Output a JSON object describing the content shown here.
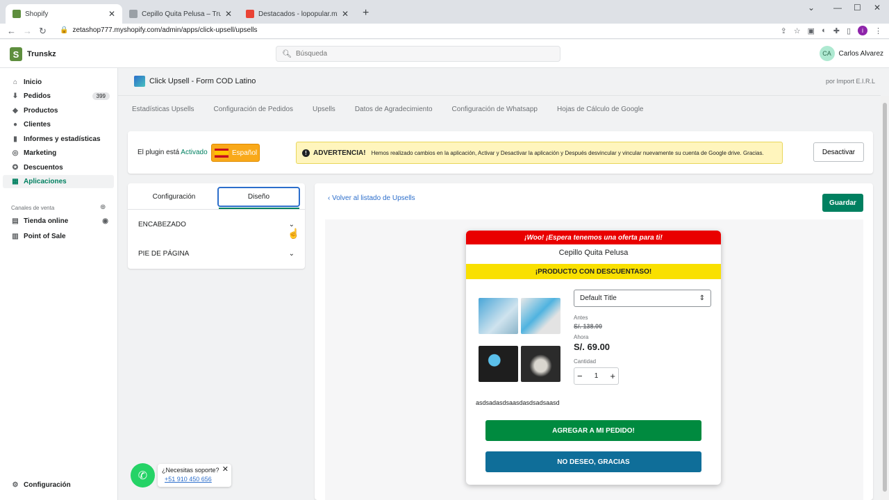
{
  "browser": {
    "tabs": [
      {
        "label": "Shopify",
        "active": true
      },
      {
        "label": "Cepillo Quita Pelusa – Trunskz",
        "active": false
      },
      {
        "label": "Destacados - lopopular.mx@gm...",
        "active": false
      }
    ],
    "url": "zetashop777.myshopify.com/admin/apps/click-upsell/upsells"
  },
  "topbar": {
    "store_name": "Trunskz",
    "search_placeholder": "Búsqueda",
    "user_initials": "CA",
    "user_name": "Carlos Alvarez"
  },
  "sidebar": {
    "items": [
      {
        "label": "Inicio",
        "icon": "home-icon"
      },
      {
        "label": "Pedidos",
        "icon": "orders-icon",
        "badge": "399"
      },
      {
        "label": "Productos",
        "icon": "tag-icon"
      },
      {
        "label": "Clientes",
        "icon": "person-icon"
      },
      {
        "label": "Informes y estadísticas",
        "icon": "bar-chart-icon"
      },
      {
        "label": "Marketing",
        "icon": "target-icon"
      },
      {
        "label": "Descuentos",
        "icon": "discount-icon"
      },
      {
        "label": "Aplicaciones",
        "icon": "apps-icon",
        "active": true
      }
    ],
    "channels_title": "Canales de venta",
    "channels": [
      {
        "label": "Tienda online",
        "icon": "store-icon"
      },
      {
        "label": "Point of Sale",
        "icon": "pos-icon"
      }
    ],
    "settings_label": "Configuración"
  },
  "app": {
    "title": "Click Upsell - Form COD Latino",
    "byline": "por Import E.I.R.L",
    "tabs": [
      "Estadísticas Upsells",
      "Configuración de Pedidos",
      "Upsells",
      "Datos de Agradecimiento",
      "Configuración de Whatsapp",
      "Hojas de Cálculo de Google"
    ],
    "plugin_state_prefix": "El plugin está",
    "plugin_state": "Activado",
    "language": "Español",
    "warning_title": "ADVERTENCIA!",
    "warning_text": "Hemos realizado cambios en la aplicación, Activar y Desactivar la aplicación y Después desvincular y vincular nuevamente su cuenta de Google drive. Gracias.",
    "deactivate_label": "Desactivar"
  },
  "panel": {
    "tab_config": "Configuración",
    "tab_design": "Diseño",
    "sections": [
      "ENCABEZADO",
      "PIE DE PÁGINA"
    ]
  },
  "editor": {
    "back_label": "Volver al listado de Upsells",
    "save_label": "Guardar"
  },
  "popup": {
    "header_text": "¡Woo! ¡Espera tenemos una oferta para ti!",
    "product_name": "Cepillo Quita Pelusa",
    "discount_banner": "¡PRODUCTO CON DESCUENTASO!",
    "variant": "Default Title",
    "before_label": "Antes",
    "before_price": "S/. 138.00",
    "now_label": "Ahora",
    "now_price": "S/. 69.00",
    "quantity_label": "Cantidad",
    "quantity": "1",
    "description": "asdsadasdsaasdasdsadsaasd",
    "accept_label": "AGREGAR A MI PEDIDO!",
    "decline_label": "NO DESEO, GRACIAS"
  },
  "support": {
    "question": "¿Necesitas soporte?",
    "phone": "+51 910 450 656"
  },
  "colors": {
    "shopify_green": "#008060",
    "popup_red": "#e90000",
    "popup_yellow": "#f9e000",
    "accept_green": "#008a3f",
    "decline_blue": "#0f6e99"
  }
}
